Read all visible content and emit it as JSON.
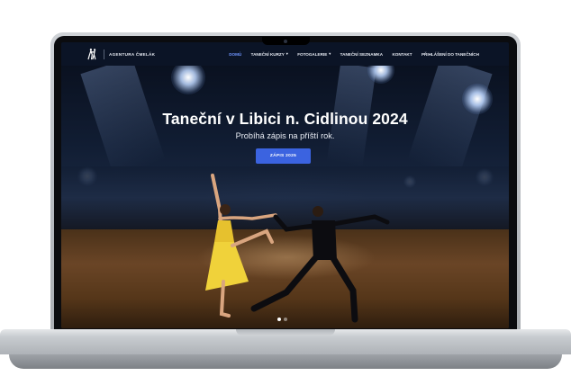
{
  "brand": {
    "name": "AGENTURA ČMELÁK",
    "logo_icon": "dancing-couple-logo-icon"
  },
  "nav": {
    "items": [
      {
        "label": "DOMŮ",
        "active": true,
        "dropdown": false
      },
      {
        "label": "TANEČNÍ KURZY",
        "active": false,
        "dropdown": true
      },
      {
        "label": "FOTOGALERIE",
        "active": false,
        "dropdown": true
      },
      {
        "label": "TANEČNÍ SEZNAMKA",
        "active": false,
        "dropdown": false
      },
      {
        "label": "KONTAKT",
        "active": false,
        "dropdown": false
      },
      {
        "label": "PŘIHLÁŠENÍ DO TANEČNÍCH",
        "active": false,
        "dropdown": false
      }
    ],
    "dropdown_icon": "chevron-down-icon",
    "active_color": "#6f95ff"
  },
  "hero": {
    "title": "Taneční v Libici n. Cidlinou 2024",
    "subtitle": "Probíhá zápis na příští rok.",
    "cta_label": "ZÁPIS 2025",
    "cta_color": "#3b63e0",
    "slides": {
      "count": 2,
      "active": 1
    }
  },
  "colors": {
    "navbar_bg": "#0b1426",
    "hero_bg": "#111d33"
  }
}
